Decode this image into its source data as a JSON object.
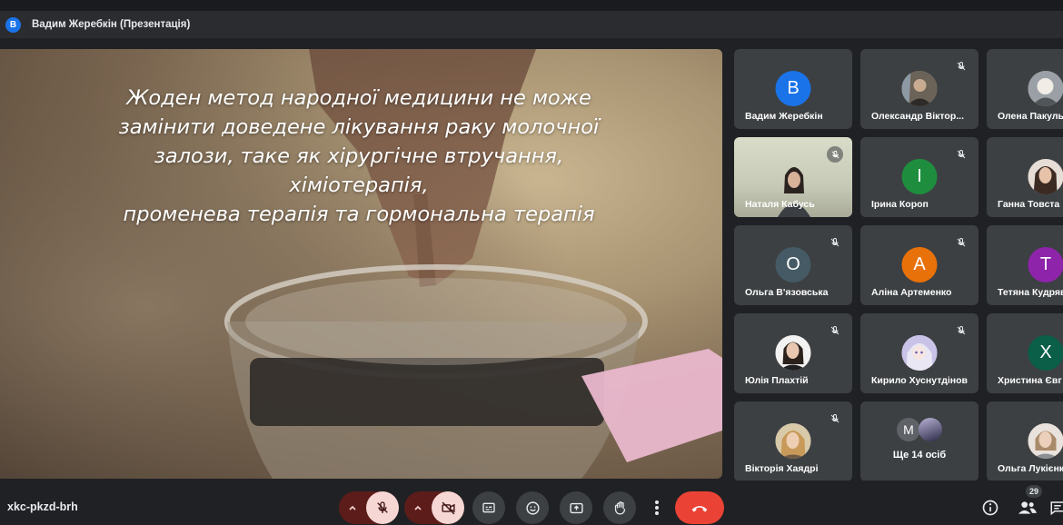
{
  "window": {
    "presenter_initial": "В",
    "title": "Вадим Жеребкін (Презентація)"
  },
  "slide": {
    "lines": [
      "Жоден метод народної медицини не може",
      "замінити доведене лікування раку молочної",
      "залози, таке як хірургічне втручання, хіміотерапія,",
      "променева терапія та гормональна терапія"
    ]
  },
  "participants": [
    {
      "name": "Вадим Жеребкін",
      "initial": "В",
      "color": "#1a73e8",
      "muted": false,
      "type": "letter"
    },
    {
      "name": "Олександр Віктор...",
      "initial": "",
      "color": "",
      "muted": true,
      "type": "photo"
    },
    {
      "name": "Олена Пакуль",
      "initial": "",
      "color": "",
      "muted": false,
      "type": "photo"
    },
    {
      "name": "Наталя Кабусь",
      "initial": "",
      "color": "",
      "muted": true,
      "type": "video"
    },
    {
      "name": "Ірина Короп",
      "initial": "І",
      "color": "#1e8e3e",
      "muted": true,
      "type": "letter"
    },
    {
      "name": "Ганна Товста",
      "initial": "",
      "color": "",
      "muted": false,
      "type": "photo"
    },
    {
      "name": "Ольга В'язовська",
      "initial": "О",
      "color": "#455a64",
      "muted": true,
      "type": "letter"
    },
    {
      "name": "Аліна Артеменко",
      "initial": "А",
      "color": "#e8710a",
      "muted": true,
      "type": "letter"
    },
    {
      "name": "Тетяна Кудряв",
      "initial": "Т",
      "color": "#8e24aa",
      "muted": false,
      "type": "letter"
    },
    {
      "name": "Юлія Плахтій",
      "initial": "",
      "color": "",
      "muted": true,
      "type": "photo"
    },
    {
      "name": "Кирило Хуснутдінов",
      "initial": "",
      "color": "",
      "muted": true,
      "type": "photo"
    },
    {
      "name": "Христина Євг",
      "initial": "Х",
      "color": "#0b5e48",
      "muted": false,
      "type": "letter"
    },
    {
      "name": "Вікторія Хаядрі",
      "initial": "",
      "color": "",
      "muted": true,
      "type": "photo"
    },
    {
      "name": "Ольга Лукієнк",
      "initial": "",
      "color": "",
      "muted": false,
      "type": "photo"
    }
  ],
  "more_tile": {
    "initial": "М",
    "label": "Ще 14 осіб"
  },
  "bottom": {
    "meeting_code": "xkc-pkzd-brh",
    "participant_count": "29"
  },
  "colors": {
    "background": "#202124",
    "tile": "#3c4043",
    "end_call": "#ea4335",
    "muted_control": "#f6d7d4"
  },
  "icons": [
    "mic-off-icon",
    "video-off-icon",
    "captions-icon",
    "emoji-icon",
    "present-icon",
    "raise-hand-icon",
    "more-options-icon",
    "end-call-icon",
    "info-icon",
    "people-icon",
    "chat-icon"
  ]
}
